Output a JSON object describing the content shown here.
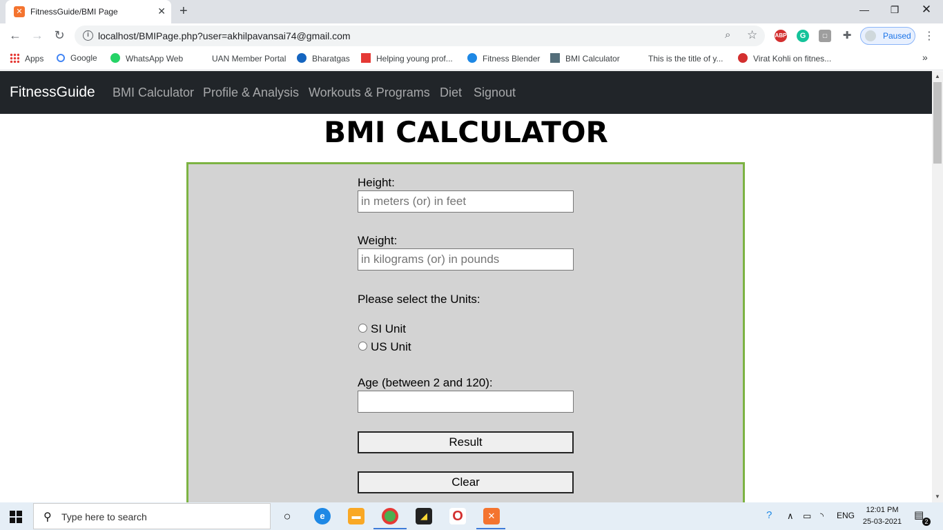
{
  "browser": {
    "tab_title": "FitnessGuide/BMI Page",
    "url": "localhost/BMIPage.php?user=akhilpavansai74@gmail.com",
    "profile_label": "Paused",
    "bookmarks": [
      {
        "label": "Apps",
        "icon": "apps-grid-icon",
        "color": "#e53935"
      },
      {
        "label": "Google",
        "icon": "google-icon",
        "color": "#4285f4"
      },
      {
        "label": "WhatsApp Web",
        "icon": "whatsapp-icon",
        "color": "#25d366"
      },
      {
        "label": "UAN Member Portal",
        "icon": "blank-page-icon",
        "color": "#ffffff"
      },
      {
        "label": "Bharatgas",
        "icon": "bharatgas-icon",
        "color": "#1565c0"
      },
      {
        "label": "Helping young prof...",
        "icon": "ux-icon",
        "color": "#e53935"
      },
      {
        "label": "Fitness Blender",
        "icon": "fitness-blender-icon",
        "color": "#1e88e5"
      },
      {
        "label": "BMI Calculator",
        "icon": "calculator-icon",
        "color": "#546e7a"
      },
      {
        "label": "This is the title of y...",
        "icon": "blank-page-icon",
        "color": "#ffffff"
      },
      {
        "label": "Virat Kohli on fitnes...",
        "icon": "in-icon",
        "color": "#d32f2f"
      }
    ]
  },
  "nav": {
    "brand": "FitnessGuide",
    "links": [
      "BMI Calculator",
      "Profile & Analysis",
      "Workouts & Programs",
      "Diet",
      "Signout"
    ]
  },
  "page": {
    "heading": "BMI CALCULATOR"
  },
  "form": {
    "height_label": "Height:",
    "height_placeholder": "in meters (or) in feet",
    "height_value": "",
    "weight_label": "Weight:",
    "weight_placeholder": "in kilograms (or) in pounds",
    "weight_value": "",
    "units_label": "Please select the Units:",
    "unit_options": [
      "SI Unit",
      "US Unit"
    ],
    "age_label": "Age (between 2 and 120):",
    "age_value": "",
    "result_button": "Result",
    "clear_button": "Clear"
  },
  "taskbar": {
    "search_placeholder": "Type here to search",
    "language": "ENG",
    "time": "12:01 PM",
    "date": "25-03-2021",
    "notification_count": "2"
  },
  "colors": {
    "navbar_bg": "#212529",
    "form_border": "#7cb342",
    "form_bg": "#d3d3d3"
  }
}
